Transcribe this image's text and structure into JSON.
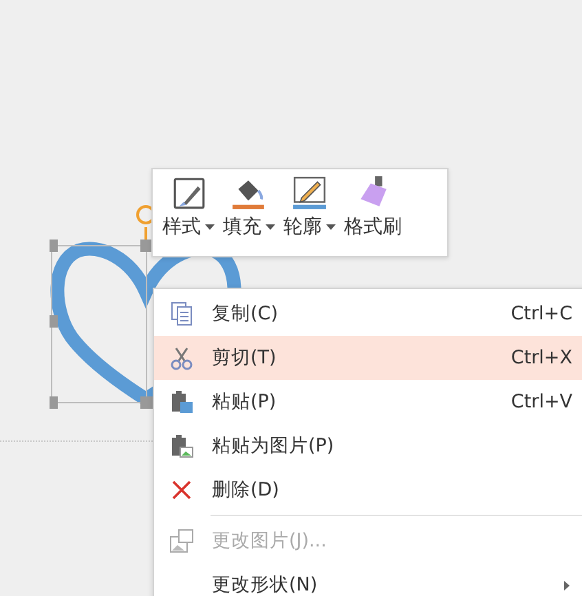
{
  "toolbar": {
    "buttons": [
      {
        "label": "样式",
        "dropdown": true
      },
      {
        "label": "填充",
        "dropdown": true
      },
      {
        "label": "轮廓",
        "dropdown": true
      },
      {
        "label": "格式刷",
        "dropdown": false
      }
    ]
  },
  "context_menu": {
    "items": [
      {
        "kind": "command",
        "label": "复制(C)",
        "shortcut": "Ctrl+C",
        "selected": false,
        "disabled": false,
        "submenu": false
      },
      {
        "kind": "command",
        "label": "剪切(T)",
        "shortcut": "Ctrl+X",
        "selected": true,
        "disabled": false,
        "submenu": false
      },
      {
        "kind": "command",
        "label": "粘贴(P)",
        "shortcut": "Ctrl+V",
        "selected": false,
        "disabled": false,
        "submenu": false
      },
      {
        "kind": "command",
        "label": "粘贴为图片(P)",
        "selected": false,
        "disabled": false,
        "submenu": false
      },
      {
        "kind": "command",
        "label": "删除(D)",
        "selected": false,
        "disabled": false,
        "submenu": false
      },
      {
        "kind": "separator"
      },
      {
        "kind": "command",
        "label": "更改图片(J)...",
        "selected": false,
        "disabled": true,
        "submenu": false
      },
      {
        "kind": "command",
        "label": "更改形状(N)",
        "selected": false,
        "disabled": false,
        "submenu": true
      }
    ]
  }
}
